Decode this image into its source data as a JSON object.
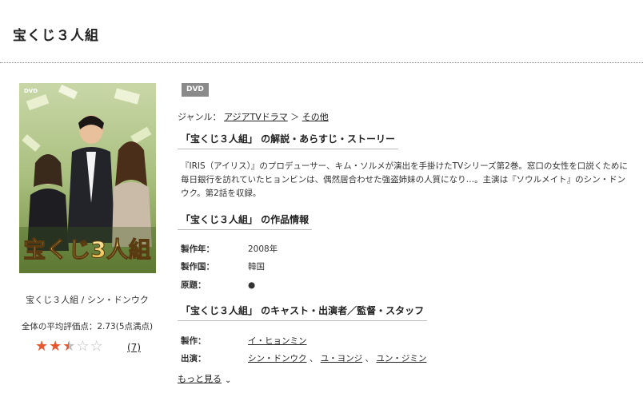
{
  "page": {
    "title": "宝くじ３人組"
  },
  "product": {
    "caption": "宝くじ３人組 / シン・ドンウク",
    "rating_text": "全体の平均評価点：2.73(5点満点)",
    "rating_value": 2.73,
    "rating_max": 5,
    "review_count": "(7)",
    "badge": "DVD",
    "cover_title_art": "宝くじ3人組",
    "cover_label": "DVD"
  },
  "genre": {
    "label": "ジャンル：",
    "items": [
      "アジアTVドラマ",
      "その他"
    ],
    "separator": "＞"
  },
  "sections": {
    "story": {
      "heading": "「宝くじ３人組」 の解説・あらすじ・ストーリー",
      "text": "『IRIS（アイリス）』のプロデューサー、キム・ソルメが演出を手掛けたTVシリーズ第2巻。窓口の女性を口説くために毎日銀行を訪れていたヒョンビンは、偶然居合わせた強盗姉妹の人質になり…。主演は『ソウルメイト』のシン・ドンウク。第2話を収録。"
    },
    "info": {
      "heading": "「宝くじ３人組」 の作品情報",
      "rows": [
        {
          "label": "製作年：",
          "value": "2008年"
        },
        {
          "label": "製作国：",
          "value": "韓国"
        },
        {
          "label": "原題：",
          "value": "●"
        }
      ]
    },
    "cast": {
      "heading": "「宝くじ３人組」 のキャスト・出演者／監督・スタッフ",
      "producer_label": "製作：",
      "producer": "イ・ヒョンミン",
      "cast_label": "出演：",
      "cast": [
        "シン・ドンウク",
        "ユ・ヨンジ",
        "ユン・ジミン"
      ],
      "cast_separator": "、",
      "more_label": "もっと見る"
    }
  }
}
